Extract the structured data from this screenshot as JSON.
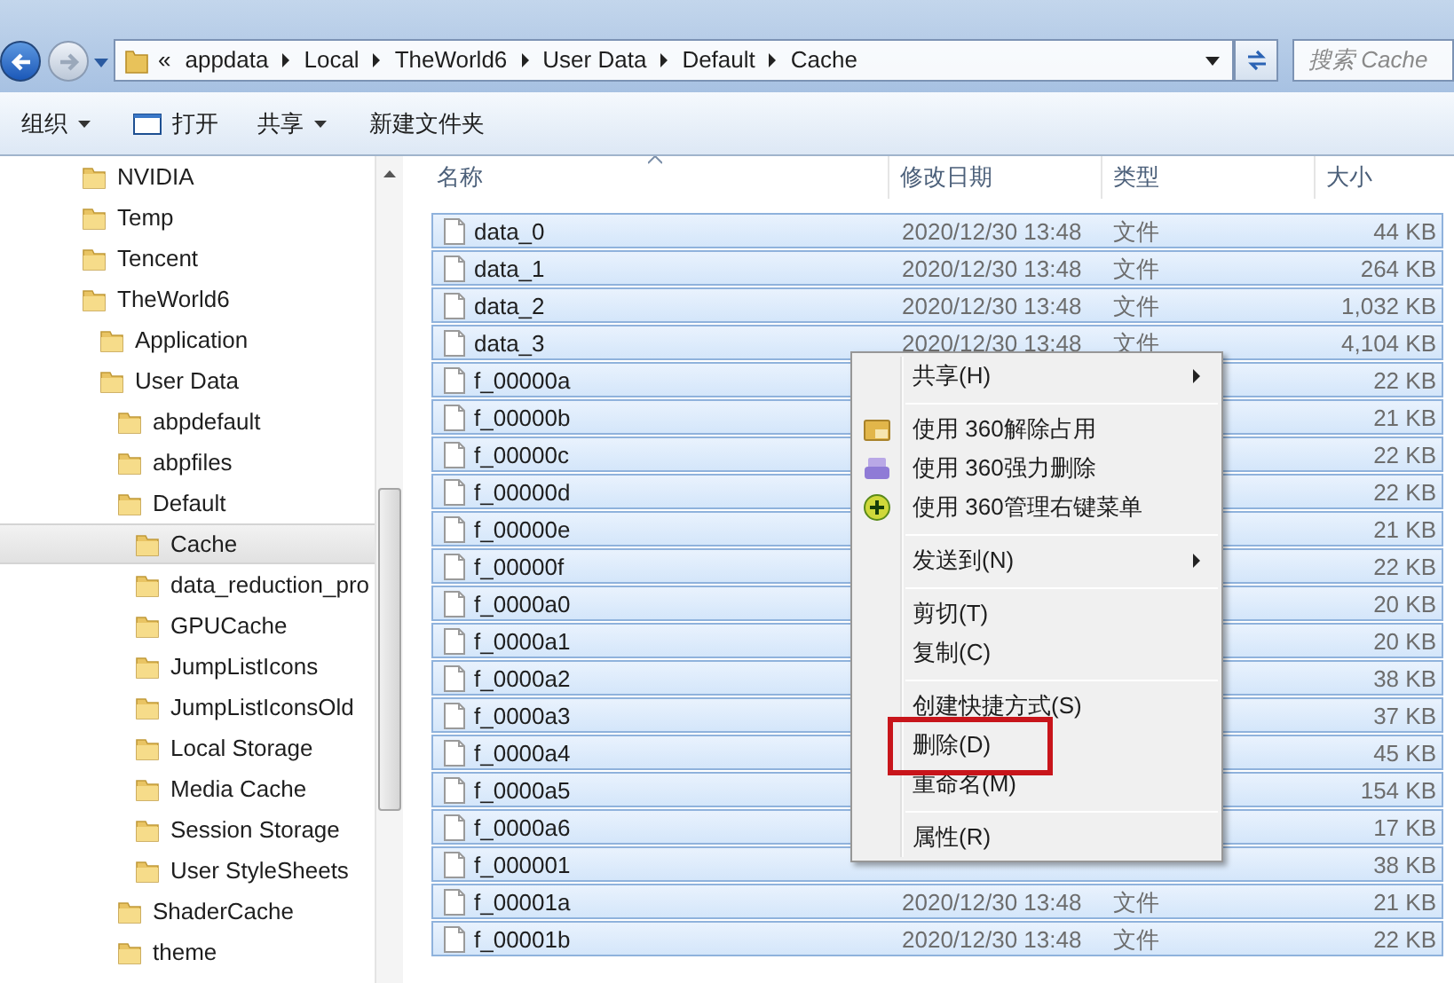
{
  "address": {
    "overflow": "«",
    "crumbs": [
      "appdata",
      "Local",
      "TheWorld6",
      "User Data",
      "Default",
      "Cache"
    ]
  },
  "search": {
    "placeholder": "搜索 Cache"
  },
  "toolbar": [
    {
      "label": "组织",
      "kind": "dropdown"
    },
    {
      "label": "打开",
      "kind": "open"
    },
    {
      "label": "共享",
      "kind": "dropdown"
    },
    {
      "label": "新建文件夹",
      "kind": "plain"
    }
  ],
  "tree": [
    {
      "label": "NVIDIA",
      "selected": false
    },
    {
      "label": "Temp",
      "selected": false
    },
    {
      "label": "Tencent",
      "selected": false
    },
    {
      "label": "TheWorld6",
      "selected": false,
      "children": [
        {
          "label": "Application",
          "selected": false
        },
        {
          "label": "User Data",
          "selected": false,
          "children": [
            {
              "label": "abpdefault",
              "selected": false
            },
            {
              "label": "abpfiles",
              "selected": false
            },
            {
              "label": "Default",
              "selected": false,
              "children": [
                {
                  "label": "Cache",
                  "selected": true
                },
                {
                  "label": "data_reduction_pro",
                  "selected": false
                },
                {
                  "label": "GPUCache",
                  "selected": false
                },
                {
                  "label": "JumpListIcons",
                  "selected": false
                },
                {
                  "label": "JumpListIconsOld",
                  "selected": false
                },
                {
                  "label": "Local Storage",
                  "selected": false
                },
                {
                  "label": "Media Cache",
                  "selected": false
                },
                {
                  "label": "Session Storage",
                  "selected": false
                },
                {
                  "label": "User StyleSheets",
                  "selected": false
                }
              ]
            },
            {
              "label": "ShaderCache",
              "selected": false
            },
            {
              "label": "theme",
              "selected": false
            }
          ]
        }
      ]
    }
  ],
  "columns": [
    "名称",
    "修改日期",
    "类型",
    "大小"
  ],
  "rows": [
    {
      "name": "data_0",
      "date": "2020/12/30 13:48",
      "type": "文件",
      "size": "44 KB",
      "selected": true
    },
    {
      "name": "data_1",
      "date": "2020/12/30 13:48",
      "type": "文件",
      "size": "264 KB",
      "selected": true
    },
    {
      "name": "data_2",
      "date": "2020/12/30 13:48",
      "type": "文件",
      "size": "1,032 KB",
      "selected": true
    },
    {
      "name": "data_3",
      "date": "2020/12/30 13:48",
      "type": "文件",
      "size": "4,104 KB",
      "selected": true
    },
    {
      "name": "f_00000a",
      "size": "22 KB",
      "selected": true
    },
    {
      "name": "f_00000b",
      "size": "21 KB",
      "selected": true
    },
    {
      "name": "f_00000c",
      "size": "22 KB",
      "selected": true
    },
    {
      "name": "f_00000d",
      "size": "22 KB",
      "selected": true
    },
    {
      "name": "f_00000e",
      "size": "21 KB",
      "selected": true
    },
    {
      "name": "f_00000f",
      "size": "22 KB",
      "selected": true
    },
    {
      "name": "f_0000a0",
      "size": "20 KB",
      "selected": true
    },
    {
      "name": "f_0000a1",
      "size": "20 KB",
      "selected": true
    },
    {
      "name": "f_0000a2",
      "size": "38 KB",
      "selected": true
    },
    {
      "name": "f_0000a3",
      "size": "37 KB",
      "selected": true
    },
    {
      "name": "f_0000a4",
      "size": "45 KB",
      "selected": true
    },
    {
      "name": "f_0000a5",
      "size": "154 KB",
      "selected": true
    },
    {
      "name": "f_0000a6",
      "size": "17 KB",
      "selected": true
    },
    {
      "name": "f_000001",
      "size": "38 KB",
      "selected": true
    },
    {
      "name": "f_00001a",
      "date": "2020/12/30 13:48",
      "type": "文件",
      "size": "21 KB",
      "selected": true
    },
    {
      "name": "f_00001b",
      "date": "2020/12/30 13:48",
      "type": "文件",
      "size": "22 KB",
      "selected": true
    }
  ],
  "context_menu": [
    {
      "kind": "item",
      "label": "共享(H)",
      "submenu": true,
      "highlighted": false
    },
    {
      "kind": "separator"
    },
    {
      "kind": "icon-item",
      "label": "使用 360解除占用",
      "submenu": false,
      "highlighted": false
    },
    {
      "kind": "icon-item",
      "label": "使用 360强力删除",
      "submenu": false,
      "highlighted": false
    },
    {
      "kind": "icon-item",
      "label": "使用 360管理右键菜单",
      "submenu": false,
      "highlighted": false
    },
    {
      "kind": "separator"
    },
    {
      "kind": "item",
      "label": "发送到(N)",
      "submenu": true,
      "highlighted": false
    },
    {
      "kind": "separator"
    },
    {
      "kind": "item",
      "label": "剪切(T)",
      "submenu": false,
      "highlighted": false
    },
    {
      "kind": "item",
      "label": "复制(C)",
      "submenu": false,
      "highlighted": false
    },
    {
      "kind": "separator"
    },
    {
      "kind": "item",
      "label": "创建快捷方式(S)",
      "submenu": false,
      "highlighted": false
    },
    {
      "kind": "item",
      "label": "删除(D)",
      "submenu": false,
      "highlighted": true
    },
    {
      "kind": "item",
      "label": "重命名(M)",
      "submenu": false,
      "highlighted": false
    },
    {
      "kind": "separator"
    },
    {
      "kind": "item",
      "label": "属性(R)",
      "submenu": false,
      "highlighted": false
    }
  ]
}
